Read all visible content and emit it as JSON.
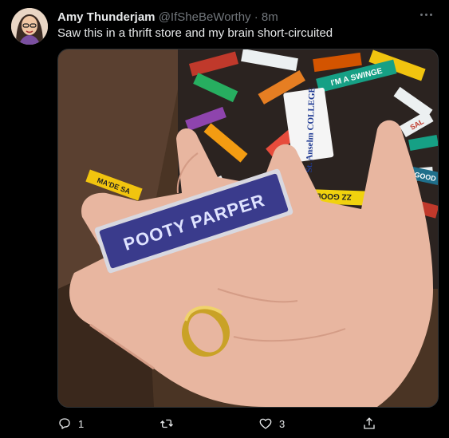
{
  "tweet": {
    "author": {
      "name": "Amy Thunderjam",
      "handle": "@IfSheBeWorthy",
      "time": "8m"
    },
    "separator": "·",
    "text": "Saw this in a thrift store and my brain short-circuited",
    "media": {
      "badge_text": "POOTY PARPER",
      "background_tags": [
        "I'M A SWINGE",
        "St. Anselm COLLEGE",
        "GOOD",
        "ZZ GOOD U",
        "SAL",
        "MA'DE SA"
      ]
    },
    "actions": {
      "reply_count": "1",
      "retweet_count": "",
      "like_count": "3"
    }
  },
  "colors": {
    "background": "#000000",
    "text_primary": "#e7e9ea",
    "text_secondary": "#71767b",
    "badge_blue": "#3a3b8c"
  },
  "icons": [
    "reply-icon",
    "retweet-icon",
    "like-icon",
    "share-icon",
    "more-icon"
  ]
}
